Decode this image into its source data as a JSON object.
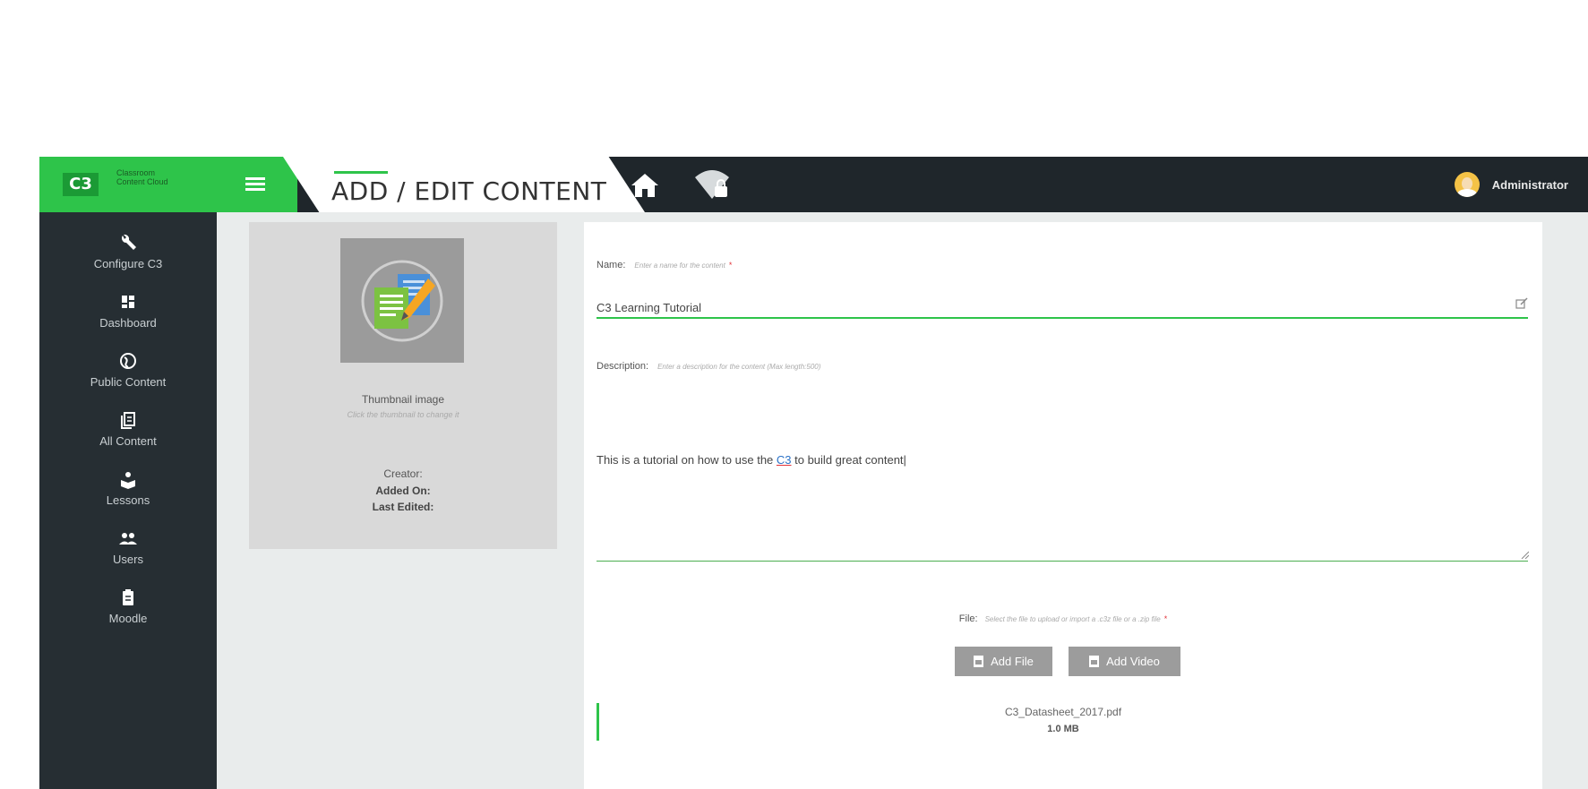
{
  "brand": {
    "logo": "C3",
    "text": "Classroom Content Cloud"
  },
  "header": {
    "title": "ADD / EDIT CONTENT",
    "user_name": "Administrator"
  },
  "sidebar": {
    "items": [
      {
        "label": "Configure C3",
        "icon": "wrench-icon"
      },
      {
        "label": "Dashboard",
        "icon": "dashboard-icon"
      },
      {
        "label": "Public Content",
        "icon": "globe-icon"
      },
      {
        "label": "All Content",
        "icon": "library-icon"
      },
      {
        "label": "Lessons",
        "icon": "lessons-icon"
      },
      {
        "label": "Users",
        "icon": "users-icon"
      },
      {
        "label": "Moodle",
        "icon": "clipboard-icon"
      }
    ]
  },
  "thumbnail": {
    "title": "Thumbnail image",
    "hint": "Click the thumbnail to change it",
    "creator_label": "Creator:",
    "added_label": "Added On:",
    "edited_label": "Last Edited:"
  },
  "form": {
    "name_label": "Name:",
    "name_hint": "Enter a name for the content",
    "name_value": "C3 Learning Tutorial",
    "required_mark": "*",
    "description_label": "Description:",
    "description_hint": "Enter a description for the content (Max length:500)",
    "description_before": "This is a tutorial on how to use the ",
    "description_link": "C3",
    "description_after": " to build great content|",
    "file_label": "File:",
    "file_hint": "Select the file to upload or import a .c3z file or a .zip file",
    "add_file": "Add File",
    "add_video": "Add Video",
    "file_name": "C3_Datasheet_2017.pdf",
    "file_size": "1.0 MB"
  },
  "colors": {
    "accent": "#2ec44a",
    "topbar": "#1f262b",
    "sidebar": "#262e33",
    "button": "#9c9c9c"
  }
}
